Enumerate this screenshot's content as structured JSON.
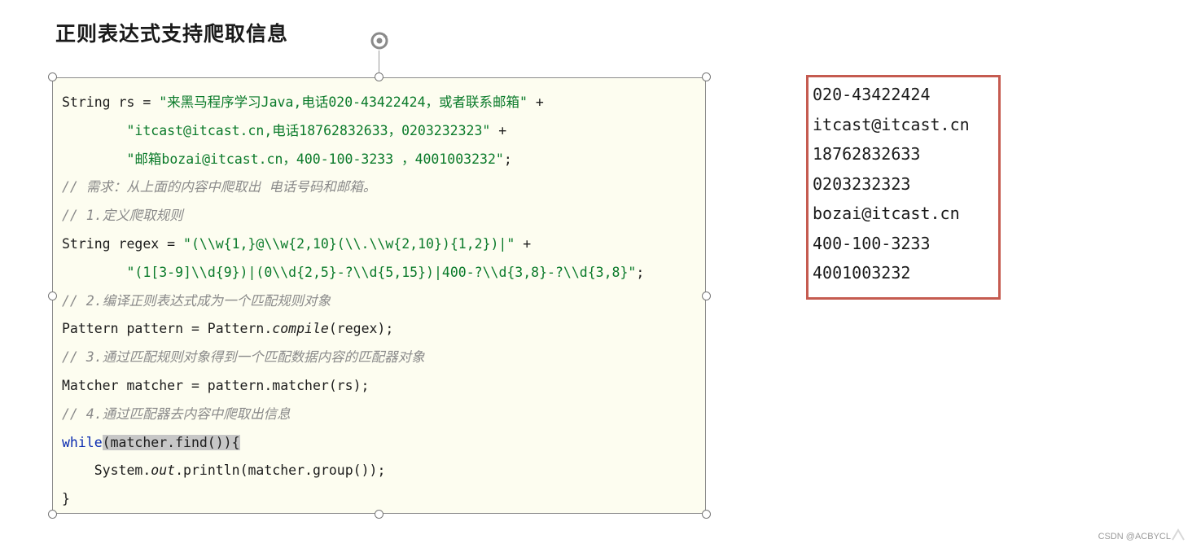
{
  "slide": {
    "title": "正则表达式支持爬取信息"
  },
  "code": {
    "l1a": "String rs = ",
    "l1b": "\"来黑马程序学习Java,电话020-43422424，或者联系邮箱\"",
    "l1c": " +",
    "l2a": "        ",
    "l2b": "\"itcast@itcast.cn,电话18762832633，0203232323\"",
    "l2c": " +",
    "l3a": "        ",
    "l3b": "\"邮箱bozai@itcast.cn，400-100-3233 ，4001003232\"",
    "l3c": ";",
    "l4": "// 需求：从上面的内容中爬取出 电话号码和邮箱。",
    "l5": "// 1.定义爬取规则",
    "l6a": "String regex = ",
    "l6b": "\"(\\\\w{1,}@\\\\w{2,10}(\\\\.\\\\w{2,10}){1,2})|\"",
    "l6c": " +",
    "l7a": "        ",
    "l7b": "\"(1[3-9]\\\\d{9})|(0\\\\d{2,5}-?\\\\d{5,15})|400-?\\\\d{3,8}-?\\\\d{3,8}\"",
    "l7c": ";",
    "l8": "// 2.编译正则表达式成为一个匹配规则对象",
    "l9a": "Pattern pattern = Pattern.",
    "l9b": "compile",
    "l9c": "(regex);",
    "l10": "// 3.通过匹配规则对象得到一个匹配数据内容的匹配器对象",
    "l11": "Matcher matcher = pattern.matcher(rs);",
    "l12": "// 4.通过匹配器去内容中爬取出信息",
    "l13a": "while",
    "l13b": "(matcher.find()){",
    "l14a": "    System.",
    "l14b": "out",
    "l14c": ".println(matcher.group());",
    "l15": "}"
  },
  "output": {
    "lines": [
      "020-43422424",
      "itcast@itcast.cn",
      "18762832633",
      "0203232323",
      "bozai@itcast.cn",
      "400-100-3233",
      "4001003232"
    ]
  },
  "watermark": "CSDN @ACBYCL",
  "colors": {
    "code_bg": "#fdfdf0",
    "string": "#0a7a2a",
    "comment": "#8a8a8a",
    "keyword": "#0a2bb0",
    "output_border": "#c55b50",
    "highlight": "#c7c7c7"
  },
  "icons": {
    "rotate": "rotate-icon",
    "corner": "corner-arrow-icon"
  }
}
